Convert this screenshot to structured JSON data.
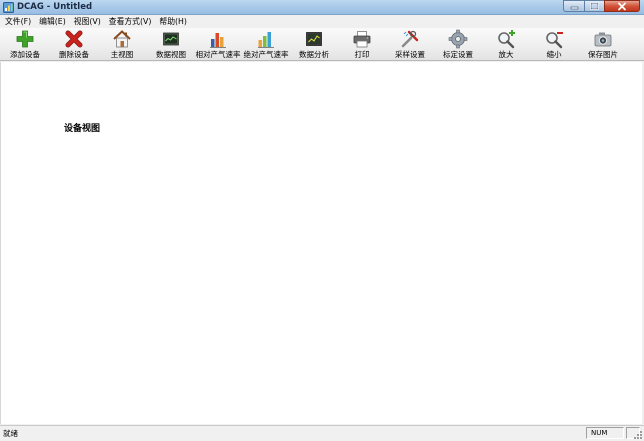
{
  "window": {
    "title": "DCAG - Untitled"
  },
  "menu": [
    "文件(F)",
    "编辑(E)",
    "视图(V)",
    "查看方式(V)",
    "帮助(H)"
  ],
  "toolbar": [
    {
      "label": "添加设备",
      "icon": "add-icon"
    },
    {
      "label": "删除设备",
      "icon": "delete-icon"
    },
    {
      "label": "主视图",
      "icon": "home-icon"
    },
    {
      "label": "数据视图",
      "icon": "data-view-icon"
    },
    {
      "label": "相对产气速率",
      "icon": "relative-rate-chart-icon"
    },
    {
      "label": "绝对产气速率",
      "icon": "absolute-rate-chart-icon"
    },
    {
      "label": "数据分析",
      "icon": "data-analysis-icon"
    },
    {
      "label": "打印",
      "icon": "printer-icon"
    },
    {
      "label": "采样设置",
      "icon": "sampling-settings-icon"
    },
    {
      "label": "标定设置",
      "icon": "calibration-gear-icon"
    },
    {
      "label": "放大",
      "icon": "zoom-in-icon"
    },
    {
      "label": "缩小",
      "icon": "zoom-out-icon"
    },
    {
      "label": "保存图片",
      "icon": "camera-icon"
    }
  ],
  "view": {
    "title": "设备视图"
  },
  "status": {
    "text": "就绪",
    "indicator": "NUM"
  },
  "colors": {
    "add": "#3fa32a",
    "delete": "#c8231c",
    "title_bar": "#a9c9e9",
    "close_button": "#c2371c"
  }
}
